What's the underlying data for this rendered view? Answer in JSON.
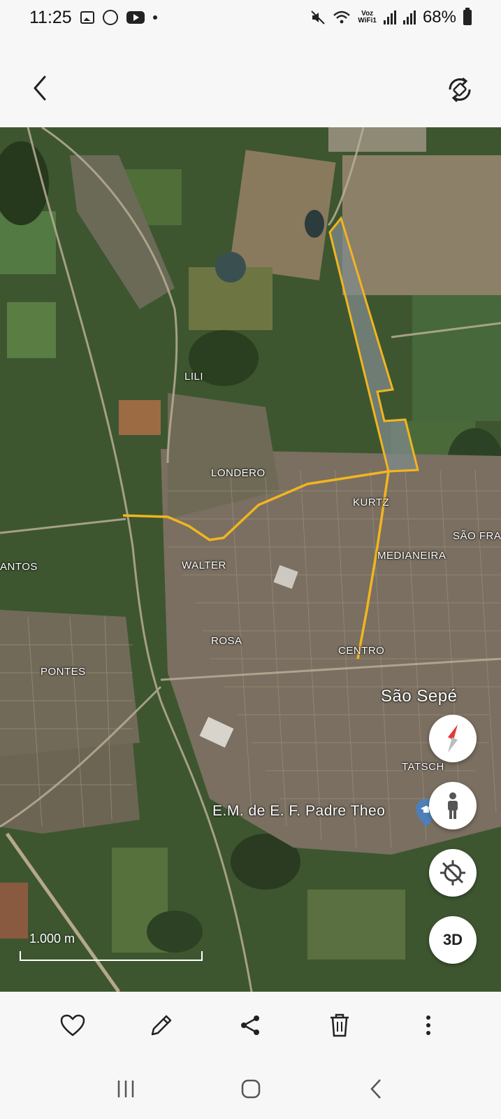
{
  "status_bar": {
    "time": "11:25",
    "voz_label": "Voz",
    "wifi_label": "WiFi1",
    "battery": "68%"
  },
  "top_bar": {
    "back_icon": "chevron-left-icon",
    "rotate_icon": "rotate-icon"
  },
  "map": {
    "labels": {
      "lili": "LILI",
      "londero": "LONDERO",
      "kurtz": "KURTZ",
      "sao_fra": "SÃO FRA",
      "medianeira": "MEDIANEIRA",
      "antos": "ANTOS",
      "walter": "WALTER",
      "rosa": "ROSA",
      "centro": "CENTRO",
      "pontes": "PONTES",
      "city": "São Sepé",
      "tatsch": "TATSCH",
      "school": "E.M. de E. F. Padre Theo"
    },
    "scale_label": "1.000 m",
    "route_color": "#f2b51f",
    "buttons": {
      "compass_icon": "compass-icon",
      "street_view_icon": "person-icon",
      "location_icon": "location-off-icon",
      "three_d_label": "3D"
    }
  },
  "actions": {
    "favorite_icon": "heart-icon",
    "edit_icon": "pencil-icon",
    "share_icon": "share-icon",
    "delete_icon": "trash-icon",
    "more_icon": "more-vertical-icon"
  },
  "nav_bar": {
    "recents_icon": "recents-icon",
    "home_icon": "home-icon",
    "back_icon": "back-icon"
  }
}
